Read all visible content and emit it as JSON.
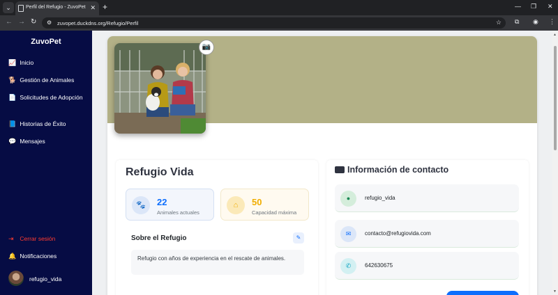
{
  "browser": {
    "tab_title": "Perfil del Refugio - ZuvoPet",
    "url": "zuvopet.duckdns.org/Refugio/Perfil"
  },
  "sidebar": {
    "brand": "ZuvoPet",
    "items": [
      {
        "label": "Inicio",
        "icon": "chart-line-icon"
      },
      {
        "label": "Gestión de Animales",
        "icon": "dog-icon"
      },
      {
        "label": "Solicitudes de Adopción",
        "icon": "document-icon"
      },
      {
        "label": "Historias de Éxito",
        "icon": "book-icon"
      },
      {
        "label": "Mensajes",
        "icon": "chat-bubbles-icon"
      }
    ],
    "logout_label": "Cerrar sesión",
    "notifications_label": "Notificaciones",
    "user_name": "refugio_vida"
  },
  "profile": {
    "name": "Refugio Vida",
    "stats": [
      {
        "value": "22",
        "label": "Animales actuales",
        "icon": "paw-icon"
      },
      {
        "value": "50",
        "label": "Capacidad máxima",
        "icon": "home-icon"
      }
    ],
    "about_title": "Sobre el Refugio",
    "about_text": "Refugio con años de experiencia en el rescate de animales."
  },
  "contact": {
    "title": "Información de contacto",
    "username": "refugio_vida",
    "email": "contacto@refugiovida.com",
    "phone": "642630675"
  },
  "colors": {
    "sidebar_bg": "#060c44",
    "banner_bg": "#b3b187",
    "accent_blue": "#0d6efd",
    "accent_yellow": "#f0ad00",
    "logout_red": "#ff3b30"
  }
}
